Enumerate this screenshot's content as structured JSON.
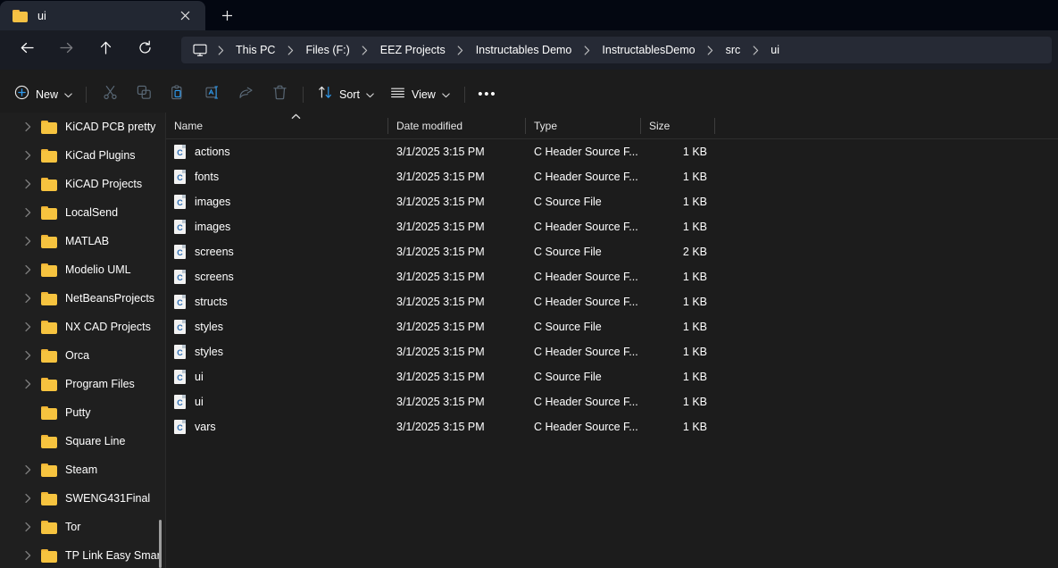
{
  "window": {
    "tab": {
      "title": "ui",
      "folder_icon": "folder-icon",
      "close_icon": "close-icon"
    },
    "new_tab_icon": "plus-icon"
  },
  "nav": {
    "back_icon": "arrow-left-icon",
    "forward_icon": "arrow-right-icon",
    "up_icon": "arrow-up-icon",
    "refresh_icon": "refresh-icon"
  },
  "address": {
    "pc_icon": "this-pc-icon",
    "separator": "›",
    "crumbs": [
      "This PC",
      "Files (F:)",
      "EEZ Projects",
      "Instructables Demo",
      "InstructablesDemo",
      "src",
      "ui"
    ]
  },
  "toolbar": {
    "new_label": "New",
    "new_icon": "plus-circle-icon",
    "new_chevron": "chevron-down-icon",
    "cut_icon": "cut-icon",
    "copy_icon": "copy-icon",
    "paste_icon": "paste-icon",
    "rename_icon": "rename-icon",
    "share_icon": "share-icon",
    "delete_icon": "trash-icon",
    "sort_label": "Sort",
    "sort_icon": "sort-arrows-icon",
    "view_label": "View",
    "view_icon": "view-list-icon",
    "more_label": "•••"
  },
  "sidebar": {
    "items": [
      {
        "label": "KiCAD PCB pretty",
        "expandable": true
      },
      {
        "label": "KiCad Plugins",
        "expandable": true
      },
      {
        "label": "KiCAD Projects",
        "expandable": true
      },
      {
        "label": "LocalSend",
        "expandable": true
      },
      {
        "label": "MATLAB",
        "expandable": true
      },
      {
        "label": "Modelio UML",
        "expandable": true
      },
      {
        "label": "NetBeansProjects",
        "expandable": true
      },
      {
        "label": "NX CAD Projects",
        "expandable": true
      },
      {
        "label": "Orca",
        "expandable": true
      },
      {
        "label": "Program Files",
        "expandable": true
      },
      {
        "label": "Putty",
        "expandable": false
      },
      {
        "label": "Square Line",
        "expandable": false
      },
      {
        "label": "Steam",
        "expandable": true
      },
      {
        "label": "SWENG431Final",
        "expandable": true
      },
      {
        "label": "Tor",
        "expandable": true
      },
      {
        "label": "TP Link Easy Smar",
        "expandable": true
      }
    ]
  },
  "filelist": {
    "columns": [
      {
        "label": "Name",
        "sorted": "asc"
      },
      {
        "label": "Date modified",
        "sorted": null
      },
      {
        "label": "Type",
        "sorted": null
      },
      {
        "label": "Size",
        "sorted": null
      }
    ],
    "rows": [
      {
        "name": "actions",
        "icon_letter": "C",
        "date": "3/1/2025 3:15 PM",
        "type": "C Header Source F...",
        "size": "1 KB"
      },
      {
        "name": "fonts",
        "icon_letter": "C",
        "date": "3/1/2025 3:15 PM",
        "type": "C Header Source F...",
        "size": "1 KB"
      },
      {
        "name": "images",
        "icon_letter": "C",
        "date": "3/1/2025 3:15 PM",
        "type": "C Source File",
        "size": "1 KB"
      },
      {
        "name": "images",
        "icon_letter": "C",
        "date": "3/1/2025 3:15 PM",
        "type": "C Header Source F...",
        "size": "1 KB"
      },
      {
        "name": "screens",
        "icon_letter": "C",
        "date": "3/1/2025 3:15 PM",
        "type": "C Source File",
        "size": "2 KB"
      },
      {
        "name": "screens",
        "icon_letter": "C",
        "date": "3/1/2025 3:15 PM",
        "type": "C Header Source F...",
        "size": "1 KB"
      },
      {
        "name": "structs",
        "icon_letter": "C",
        "date": "3/1/2025 3:15 PM",
        "type": "C Header Source F...",
        "size": "1 KB"
      },
      {
        "name": "styles",
        "icon_letter": "C",
        "date": "3/1/2025 3:15 PM",
        "type": "C Source File",
        "size": "1 KB"
      },
      {
        "name": "styles",
        "icon_letter": "C",
        "date": "3/1/2025 3:15 PM",
        "type": "C Header Source F...",
        "size": "1 KB"
      },
      {
        "name": "ui",
        "icon_letter": "C",
        "date": "3/1/2025 3:15 PM",
        "type": "C Source File",
        "size": "1 KB"
      },
      {
        "name": "ui",
        "icon_letter": "C",
        "date": "3/1/2025 3:15 PM",
        "type": "C Header Source F...",
        "size": "1 KB"
      },
      {
        "name": "vars",
        "icon_letter": "C",
        "date": "3/1/2025 3:15 PM",
        "type": "C Header Source F...",
        "size": "1 KB"
      }
    ]
  },
  "colors": {
    "titlebar_bg": "#030711",
    "navbar_bg": "#191c24",
    "addressbar_bg": "#262a35",
    "content_bg": "#1c1c1c",
    "sidebar_bg": "#1f1f1f",
    "folder_yellow": "#f6c33f",
    "accent_blue": "#2d6fb5"
  }
}
